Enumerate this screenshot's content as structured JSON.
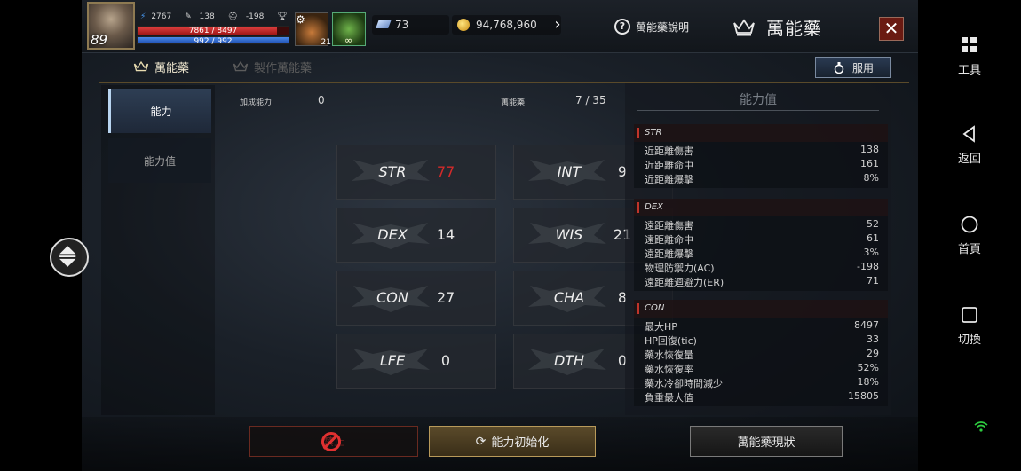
{
  "player": {
    "level": "89",
    "stat_a": "2767",
    "stat_b": "138",
    "stat_c": "-198",
    "stat_d": "-",
    "hp_text": "7861 / 8497",
    "hp_fraction": 0.925,
    "mp_text": "992 / 992",
    "mp_fraction": 1.0
  },
  "quickslots": {
    "slot1_count": "21",
    "slot2_symbol": "∞"
  },
  "currency": {
    "diamonds": "73",
    "gold": "94,768,960"
  },
  "header": {
    "help_label": "萬能藥說明",
    "title": "萬能藥",
    "close_label": "✕"
  },
  "subtabs": {
    "active": "萬能藥",
    "inactive": "製作萬能藥",
    "use_button": "服用"
  },
  "left_tabs": [
    "能力",
    "能力值"
  ],
  "info": {
    "bonus_label": "加成能力",
    "bonus_value": "0",
    "elixir_label": "萬能藥",
    "elixir_value": "7 / 35"
  },
  "stats": [
    {
      "name": "STR",
      "value": "77"
    },
    {
      "name": "INT",
      "value": "9"
    },
    {
      "name": "DEX",
      "value": "14"
    },
    {
      "name": "WIS",
      "value": "21"
    },
    {
      "name": "CON",
      "value": "27"
    },
    {
      "name": "CHA",
      "value": "8"
    },
    {
      "name": "LFE",
      "value": "0"
    },
    {
      "name": "DTH",
      "value": "0"
    }
  ],
  "ability_panel": {
    "title": "能力值",
    "sections": [
      {
        "name": "STR",
        "rows": [
          {
            "label": "近距離傷害",
            "value": "138"
          },
          {
            "label": "近距離命中",
            "value": "161"
          },
          {
            "label": "近距離爆擊",
            "value": "8%"
          }
        ]
      },
      {
        "name": "DEX",
        "rows": [
          {
            "label": "遠距離傷害",
            "value": "52"
          },
          {
            "label": "遠距離命中",
            "value": "61"
          },
          {
            "label": "遠距離爆擊",
            "value": "3%"
          },
          {
            "label": "物理防禦力(AC)",
            "value": "-198"
          },
          {
            "label": "遠距離迴避力(ER)",
            "value": "71"
          }
        ]
      },
      {
        "name": "CON",
        "rows": [
          {
            "label": "最大HP",
            "value": "8497"
          },
          {
            "label": "HP回復(tic)",
            "value": "33"
          },
          {
            "label": "藥水恢復量",
            "value": "29"
          },
          {
            "label": "藥水恢復率",
            "value": "52%"
          },
          {
            "label": "藥水冷卻時間減少",
            "value": "18%"
          },
          {
            "label": "負重最大值",
            "value": "15805"
          }
        ]
      }
    ]
  },
  "buttons": {
    "forbid": "禁止",
    "reset": "能力初始化",
    "status": "萬能藥現狀"
  },
  "side": {
    "tools": "工具",
    "back": "返回",
    "home": "首頁",
    "switch": "切換"
  }
}
